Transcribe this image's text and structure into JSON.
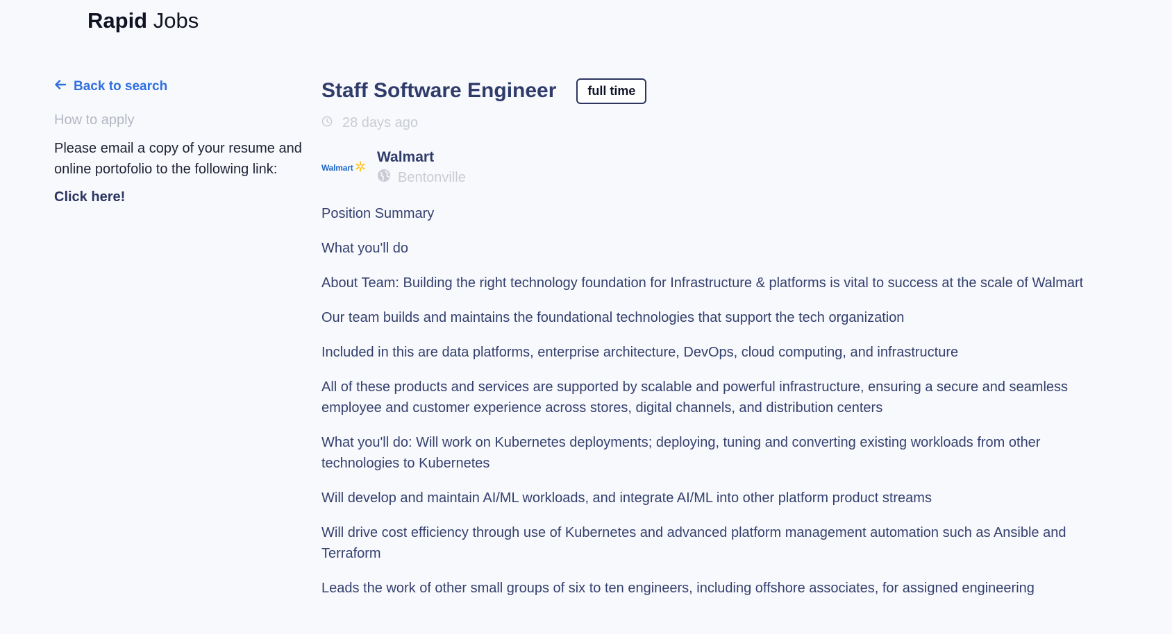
{
  "header": {
    "brand_bold": "Rapid",
    "brand_light": "Jobs"
  },
  "sidebar": {
    "back_label": "Back to search",
    "apply_heading": "How to apply",
    "apply_text": "Please email a copy of your resume and online portofolio to the following link:",
    "apply_link": "Click here!"
  },
  "job": {
    "title": "Staff Software Engineer",
    "type": "full time",
    "posted": "28 days ago",
    "company": {
      "name": "Walmart",
      "logo_text": "Walmart",
      "location": "Bentonville"
    },
    "description": [
      "Position Summary",
      "What you'll do",
      "About Team: Building the right technology foundation for Infrastructure & platforms is vital to success at the scale of Walmart",
      "Our team builds and maintains the foundational technologies that support the tech organization",
      "Included in this are data platforms, enterprise architecture, DevOps, cloud computing, and infrastructure",
      "All of these products and services are supported by scalable and powerful infrastructure, ensuring a secure and seamless employee and customer experience across stores, digital channels, and distribution centers",
      "What you'll do: Will work on Kubernetes deployments; deploying, tuning and converting existing workloads from other technologies to Kubernetes",
      "Will develop and maintain AI/ML workloads, and integrate AI/ML into other platform product streams",
      "Will drive cost efficiency through use of Kubernetes and advanced platform management automation such as Ansible and Terraform",
      "Leads the work of other small groups of six to ten engineers, including offshore associates, for assigned engineering"
    ]
  },
  "colors": {
    "accent": "#2f6fde",
    "title": "#2f3b6a",
    "body_text": "#34406e",
    "muted": "#c9ccd4",
    "logo_blue": "#1f67c6",
    "logo_spark": "#ffc220"
  },
  "icons": {
    "back": "arrow-left-icon",
    "posted": "clock-icon",
    "location": "globe-icon",
    "logo_spark": "spark-icon"
  }
}
